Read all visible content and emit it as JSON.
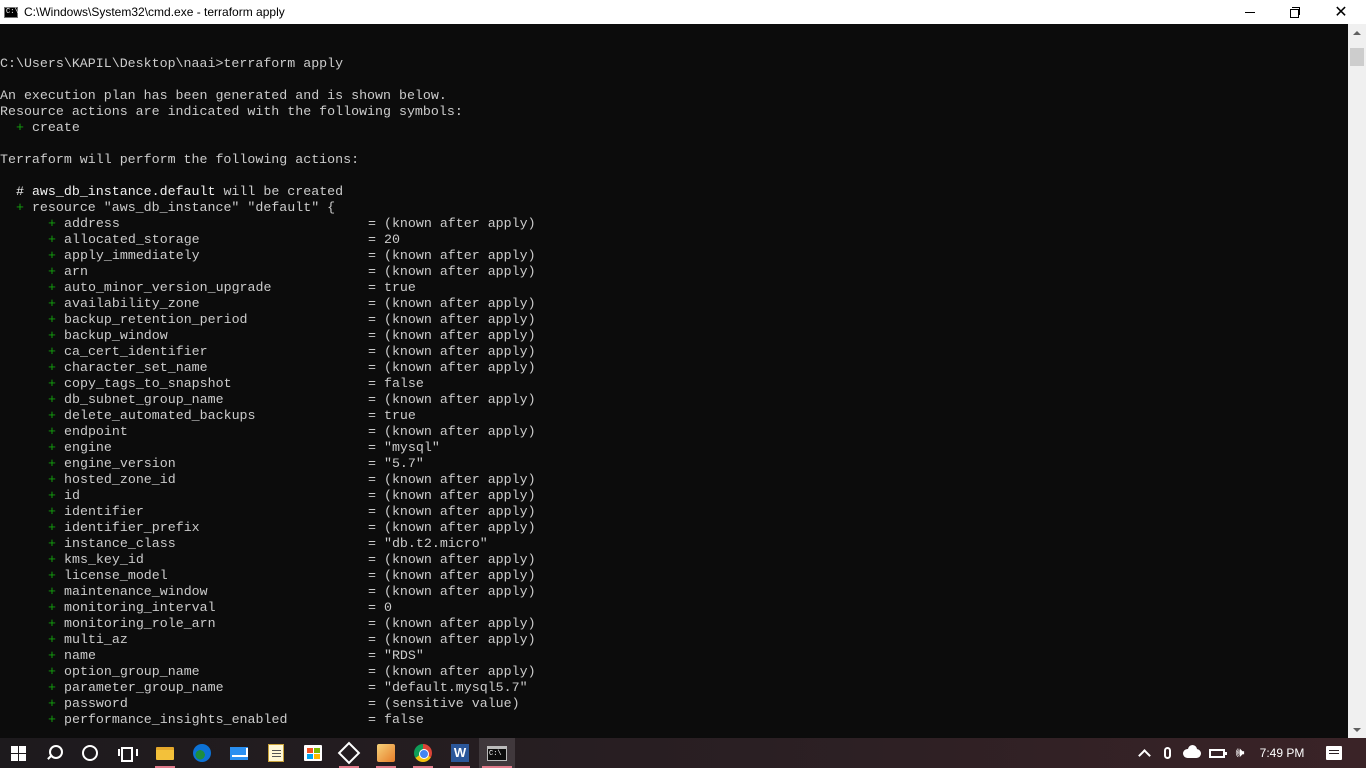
{
  "window": {
    "title": "C:\\Windows\\System32\\cmd.exe - terraform  apply",
    "icon": "cmd-icon",
    "controls": [
      "minimize",
      "restore",
      "close"
    ]
  },
  "console": {
    "prompt": "C:\\Users\\KAPIL\\Desktop\\naai>terraform apply",
    "intro1": "An execution plan has been generated and is shown below.",
    "intro2": "Resource actions are indicated with the following symbols:",
    "symbol_plus": "+",
    "symbol_label": "create",
    "actions_header": "Terraform will perform the following actions:",
    "comment_hash": "#",
    "resource_address": "aws_db_instance.default",
    "comment_suffix": "will be created",
    "resource_decl": "resource \"aws_db_instance\" \"default\" {",
    "attributes": [
      {
        "name": "address",
        "value": "(known after apply)"
      },
      {
        "name": "allocated_storage",
        "value": "20"
      },
      {
        "name": "apply_immediately",
        "value": "(known after apply)"
      },
      {
        "name": "arn",
        "value": "(known after apply)"
      },
      {
        "name": "auto_minor_version_upgrade",
        "value": "true"
      },
      {
        "name": "availability_zone",
        "value": "(known after apply)"
      },
      {
        "name": "backup_retention_period",
        "value": "(known after apply)"
      },
      {
        "name": "backup_window",
        "value": "(known after apply)"
      },
      {
        "name": "ca_cert_identifier",
        "value": "(known after apply)"
      },
      {
        "name": "character_set_name",
        "value": "(known after apply)"
      },
      {
        "name": "copy_tags_to_snapshot",
        "value": "false"
      },
      {
        "name": "db_subnet_group_name",
        "value": "(known after apply)"
      },
      {
        "name": "delete_automated_backups",
        "value": "true"
      },
      {
        "name": "endpoint",
        "value": "(known after apply)"
      },
      {
        "name": "engine",
        "value": "\"mysql\""
      },
      {
        "name": "engine_version",
        "value": "\"5.7\""
      },
      {
        "name": "hosted_zone_id",
        "value": "(known after apply)"
      },
      {
        "name": "id",
        "value": "(known after apply)"
      },
      {
        "name": "identifier",
        "value": "(known after apply)"
      },
      {
        "name": "identifier_prefix",
        "value": "(known after apply)"
      },
      {
        "name": "instance_class",
        "value": "\"db.t2.micro\""
      },
      {
        "name": "kms_key_id",
        "value": "(known after apply)"
      },
      {
        "name": "license_model",
        "value": "(known after apply)"
      },
      {
        "name": "maintenance_window",
        "value": "(known after apply)"
      },
      {
        "name": "monitoring_interval",
        "value": "0"
      },
      {
        "name": "monitoring_role_arn",
        "value": "(known after apply)"
      },
      {
        "name": "multi_az",
        "value": "(known after apply)"
      },
      {
        "name": "name",
        "value": "\"RDS\""
      },
      {
        "name": "option_group_name",
        "value": "(known after apply)"
      },
      {
        "name": "parameter_group_name",
        "value": "\"default.mysql5.7\""
      },
      {
        "name": "password",
        "value": "(sensitive value)"
      },
      {
        "name": "performance_insights_enabled",
        "value": "false"
      }
    ],
    "equals": "=",
    "colors": {
      "background": "#0c0c0c",
      "text": "#cccccc",
      "plus": "#13a10e",
      "bright": "#f2f2f2"
    }
  },
  "taskbar": {
    "items": [
      {
        "name": "start-button",
        "icon": "windows-logo-icon"
      },
      {
        "name": "search-button",
        "icon": "search-icon"
      },
      {
        "name": "cortana-button",
        "icon": "cortana-circle-icon"
      },
      {
        "name": "task-view-button",
        "icon": "task-view-icon"
      },
      {
        "name": "file-explorer",
        "icon": "folder-icon"
      },
      {
        "name": "edge",
        "icon": "edge-icon"
      },
      {
        "name": "mail",
        "icon": "mail-icon"
      },
      {
        "name": "notepad",
        "icon": "notepad-icon"
      },
      {
        "name": "microsoft-store",
        "icon": "store-icon"
      },
      {
        "name": "3d-viewer",
        "icon": "cube-icon"
      },
      {
        "name": "paint",
        "icon": "paint-icon"
      },
      {
        "name": "chrome",
        "icon": "chrome-icon"
      },
      {
        "name": "word",
        "icon": "word-icon"
      },
      {
        "name": "command-prompt",
        "icon": "cmd-icon"
      }
    ],
    "word_letter": "W",
    "cmd_glyph": "C:\\",
    "tray": {
      "time": "7:49 PM",
      "icons": [
        "chevron-up-icon",
        "microphone-icon",
        "onedrive-cloud-icon",
        "battery-icon",
        "speaker-icon",
        "notification-icon"
      ],
      "speaker_glyph": "🕪"
    }
  }
}
